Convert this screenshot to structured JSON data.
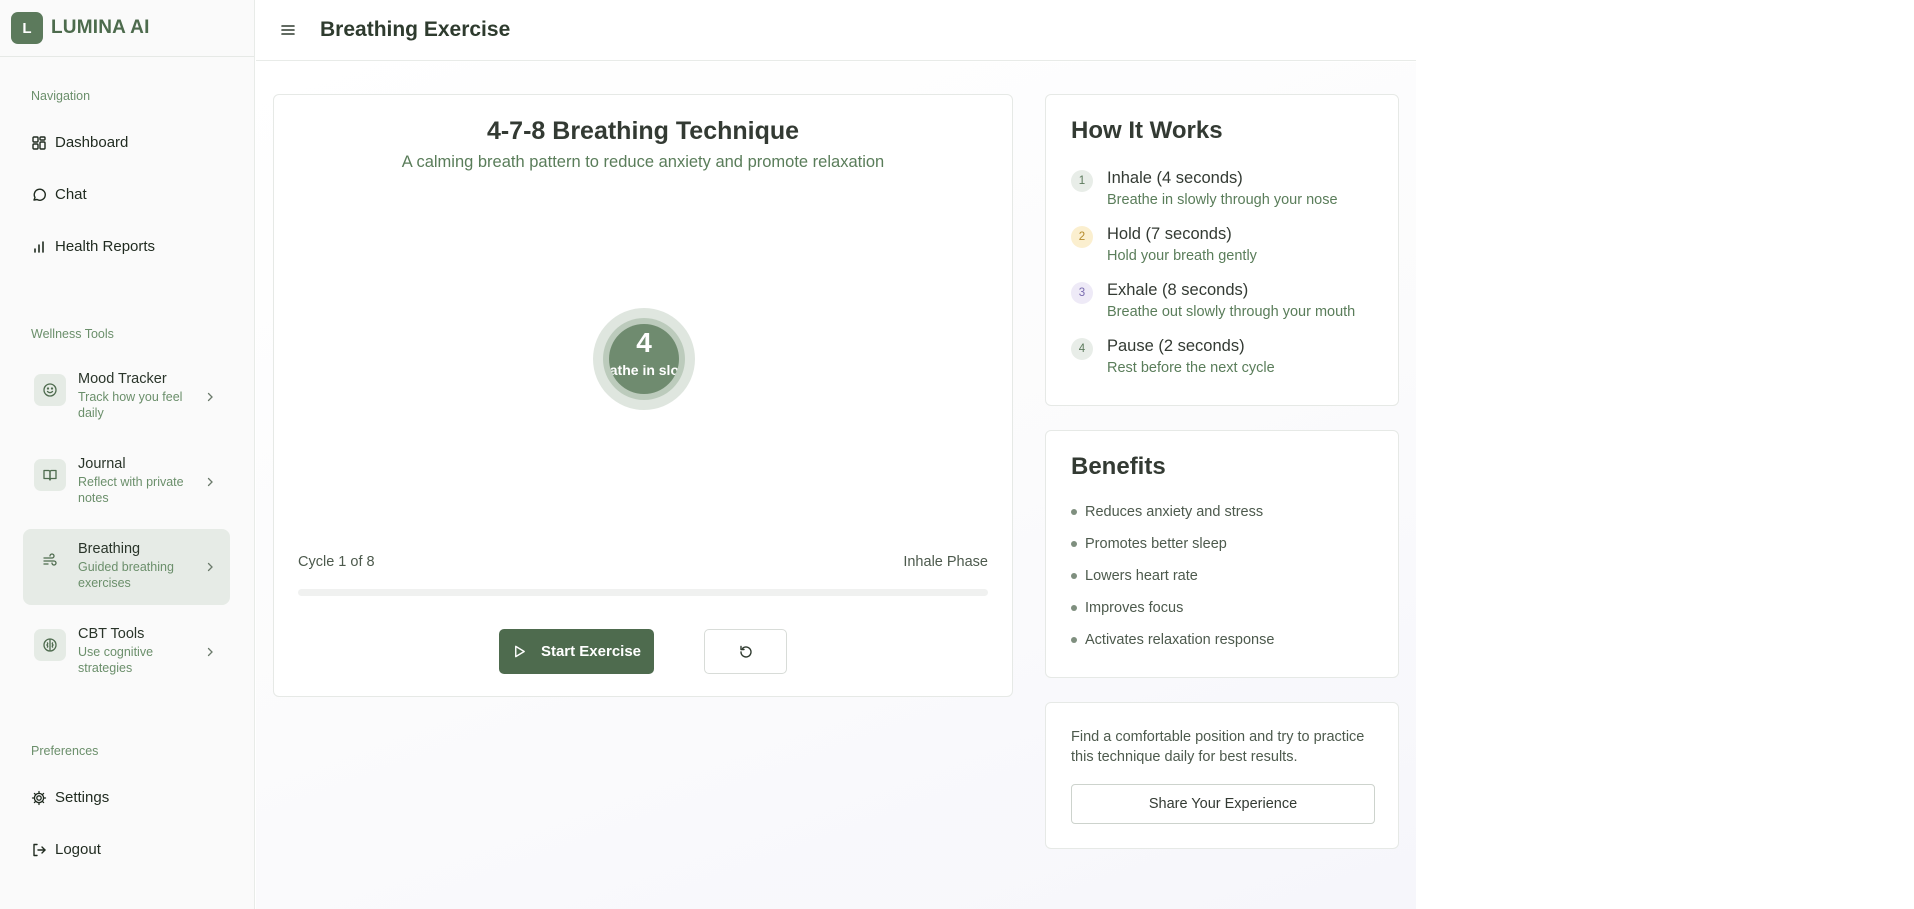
{
  "brand": {
    "logo_letter": "L",
    "name": "LUMINA AI"
  },
  "header": {
    "title": "Breathing Exercise"
  },
  "sidebar": {
    "nav_label": "Navigation",
    "nav_items": [
      {
        "label": "Dashboard",
        "icon": "dashboard-icon"
      },
      {
        "label": "Chat",
        "icon": "chat-icon"
      },
      {
        "label": "Health Reports",
        "icon": "bar-chart-icon"
      }
    ],
    "tools_label": "Wellness Tools",
    "tools": [
      {
        "title": "Mood Tracker",
        "subtitle": "Track how you feel daily",
        "icon": "smile-icon"
      },
      {
        "title": "Journal",
        "subtitle": "Reflect with private notes",
        "icon": "book-icon"
      },
      {
        "title": "Breathing",
        "subtitle": "Guided breathing exercises",
        "icon": "wind-icon",
        "active": true
      },
      {
        "title": "CBT Tools",
        "subtitle": "Use cognitive strategies",
        "icon": "brain-icon"
      }
    ],
    "prefs_label": "Preferences",
    "pref_items": [
      {
        "label": "Settings",
        "icon": "gear-icon"
      },
      {
        "label": "Logout",
        "icon": "logout-icon"
      }
    ]
  },
  "exercise": {
    "title": "4-7-8 Breathing Technique",
    "subtitle": "A calming breath pattern to reduce anxiety and promote relaxation",
    "count": "4",
    "circle_text": "Breathe in slowly",
    "cycle": "Cycle 1 of 8",
    "phase": "Inhale Phase",
    "progress": 0,
    "start_label": "Start Exercise"
  },
  "how_it_works": {
    "title": "How It Works",
    "steps": [
      {
        "num": "1",
        "title": "Inhale (4 seconds)",
        "desc": "Breathe in slowly through your nose",
        "color": "#5c7a5c",
        "bg": "#e8ede8"
      },
      {
        "num": "2",
        "title": "Hold (7 seconds)",
        "desc": "Hold your breath gently",
        "color": "#b58a2a",
        "bg": "#fbefcf"
      },
      {
        "num": "3",
        "title": "Exhale (8 seconds)",
        "desc": "Breathe out slowly through your mouth",
        "color": "#7a6bb0",
        "bg": "#eeeaf7"
      },
      {
        "num": "4",
        "title": "Pause (2 seconds)",
        "desc": "Rest before the next cycle",
        "color": "#5c7a5c",
        "bg": "#e8ede8"
      }
    ]
  },
  "benefits": {
    "title": "Benefits",
    "items": [
      "Reduces anxiety and stress",
      "Promotes better sleep",
      "Lowers heart rate",
      "Improves focus",
      "Activates relaxation response"
    ]
  },
  "tip": {
    "text": "Find a comfortable position and try to practice this technique daily for best results.",
    "button_label": "Share Your Experience"
  },
  "colors": {
    "accent": "#4e6b4e",
    "muted_green": "#6b8f6b"
  }
}
